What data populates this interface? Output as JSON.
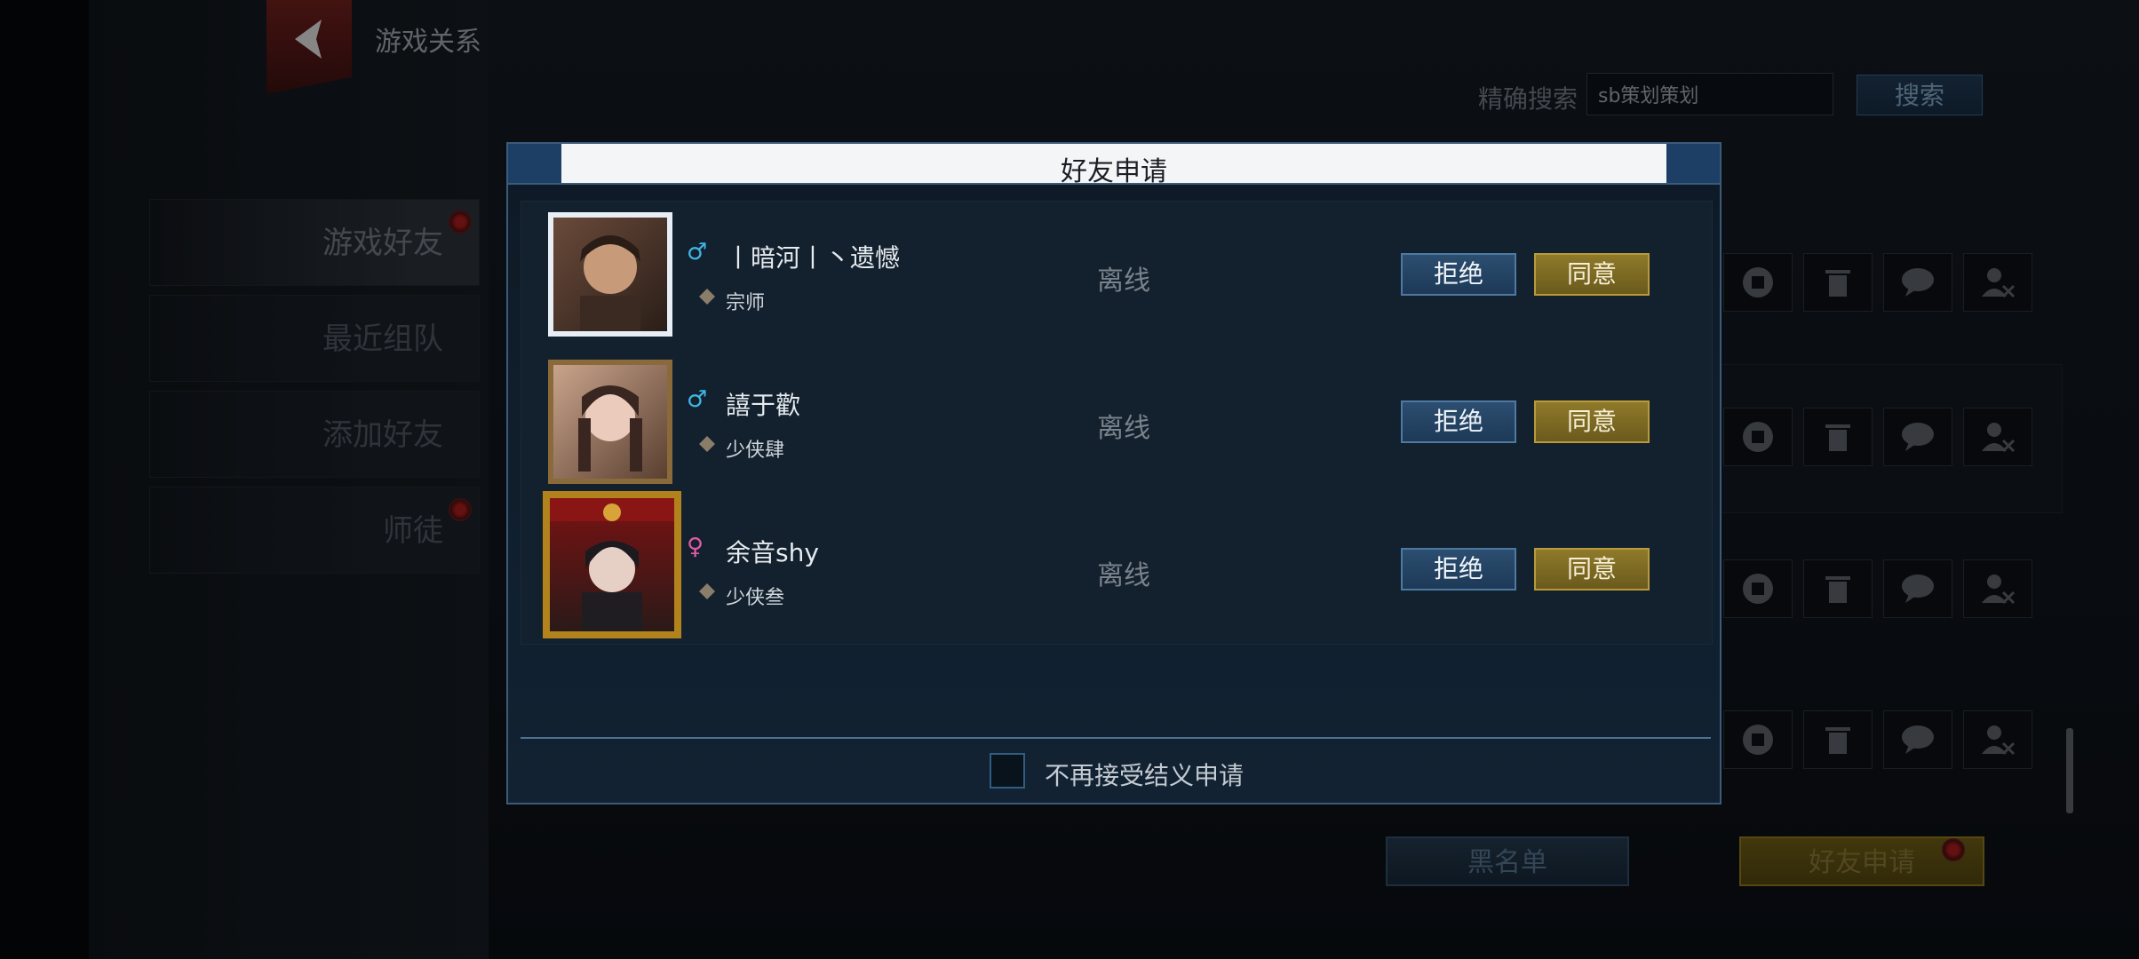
{
  "page": {
    "title": "游戏关系",
    "search": {
      "label": "精确搜索",
      "value": "sb策划策划",
      "button": "搜索"
    }
  },
  "sidebar": {
    "items": [
      {
        "label": "游戏好友",
        "active": true,
        "badge": true
      },
      {
        "label": "最近组队",
        "active": false,
        "badge": false
      },
      {
        "label": "添加好友",
        "active": false,
        "badge": false
      },
      {
        "label": "师徒",
        "active": false,
        "badge": true
      }
    ]
  },
  "bottom": {
    "blacklist": "黑名单",
    "friend_requests": "好友申请"
  },
  "modal": {
    "title": "好友申请",
    "requests": [
      {
        "name": "丨暗河丨丶遗憾",
        "rank": "宗师",
        "status": "离线",
        "gender": "male",
        "reject": "拒绝",
        "agree": "同意"
      },
      {
        "name": "譆于歡",
        "rank": "少侠肆",
        "status": "离线",
        "gender": "male",
        "reject": "拒绝",
        "agree": "同意"
      },
      {
        "name": "余音shy",
        "rank": "少侠叁",
        "status": "离线",
        "gender": "female",
        "reject": "拒绝",
        "agree": "同意"
      }
    ],
    "checkbox": {
      "label": "不再接受结义申请",
      "checked": false
    }
  },
  "colors": {
    "accent_blue": "#2c4e70",
    "accent_gold": "#8f7a2a",
    "male": "#3fb7e6",
    "female": "#e05aa8",
    "badge_red": "#a21c1c"
  }
}
